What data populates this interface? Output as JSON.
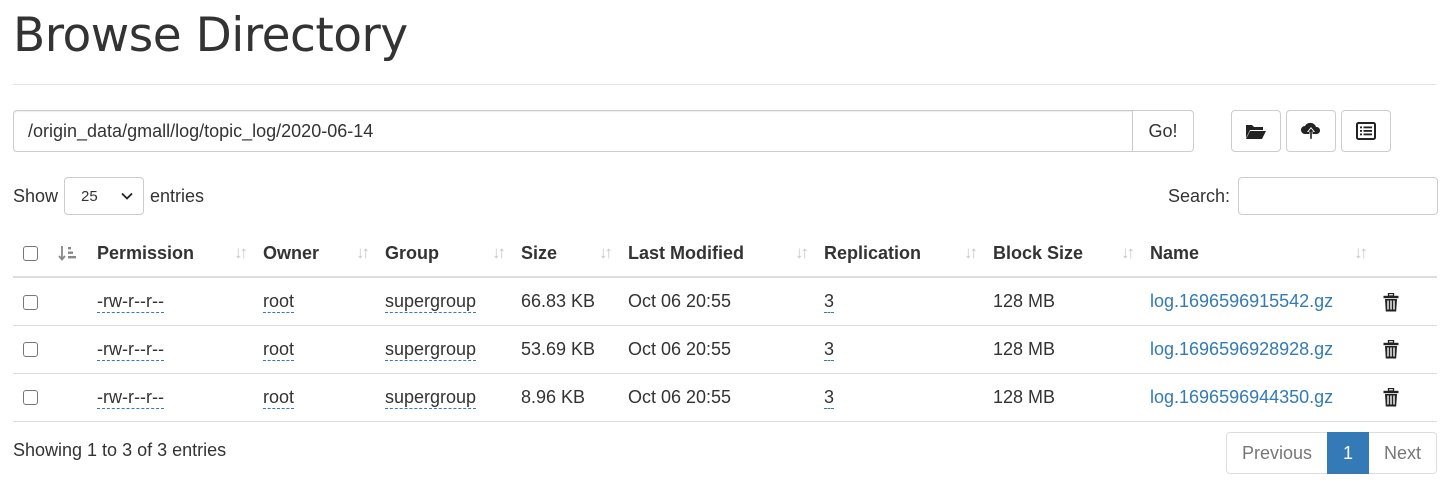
{
  "page": {
    "title": "Browse Directory"
  },
  "path_bar": {
    "value": "/origin_data/gmall/log/topic_log/2020-06-14",
    "go_label": "Go!"
  },
  "toolbar": {
    "buttons": [
      {
        "icon": "folder-open-icon"
      },
      {
        "icon": "cloud-upload-icon"
      },
      {
        "icon": "list-alt-icon"
      }
    ]
  },
  "entries": {
    "show_label": "Show",
    "page_size": "25",
    "entries_label": "entries"
  },
  "search": {
    "label": "Search:",
    "value": ""
  },
  "table": {
    "columns": [
      "Permission",
      "Owner",
      "Group",
      "Size",
      "Last Modified",
      "Replication",
      "Block Size",
      "Name"
    ],
    "rows": [
      {
        "permission": "-rw-r--r--",
        "owner": "root",
        "group": "supergroup",
        "size": "66.83 KB",
        "modified": "Oct 06 20:55",
        "replication": "3",
        "block_size": "128 MB",
        "name": "log.1696596915542.gz"
      },
      {
        "permission": "-rw-r--r--",
        "owner": "root",
        "group": "supergroup",
        "size": "53.69 KB",
        "modified": "Oct 06 20:55",
        "replication": "3",
        "block_size": "128 MB",
        "name": "log.1696596928928.gz"
      },
      {
        "permission": "-rw-r--r--",
        "owner": "root",
        "group": "supergroup",
        "size": "8.96 KB",
        "modified": "Oct 06 20:55",
        "replication": "3",
        "block_size": "128 MB",
        "name": "log.1696596944350.gz"
      }
    ]
  },
  "footer": {
    "info": "Showing 1 to 3 of 3 entries"
  },
  "pagination": {
    "previous": "Previous",
    "current": "1",
    "next": "Next"
  },
  "colors": {
    "link": "#337ab7",
    "border": "#dddddd",
    "text": "#333333"
  }
}
